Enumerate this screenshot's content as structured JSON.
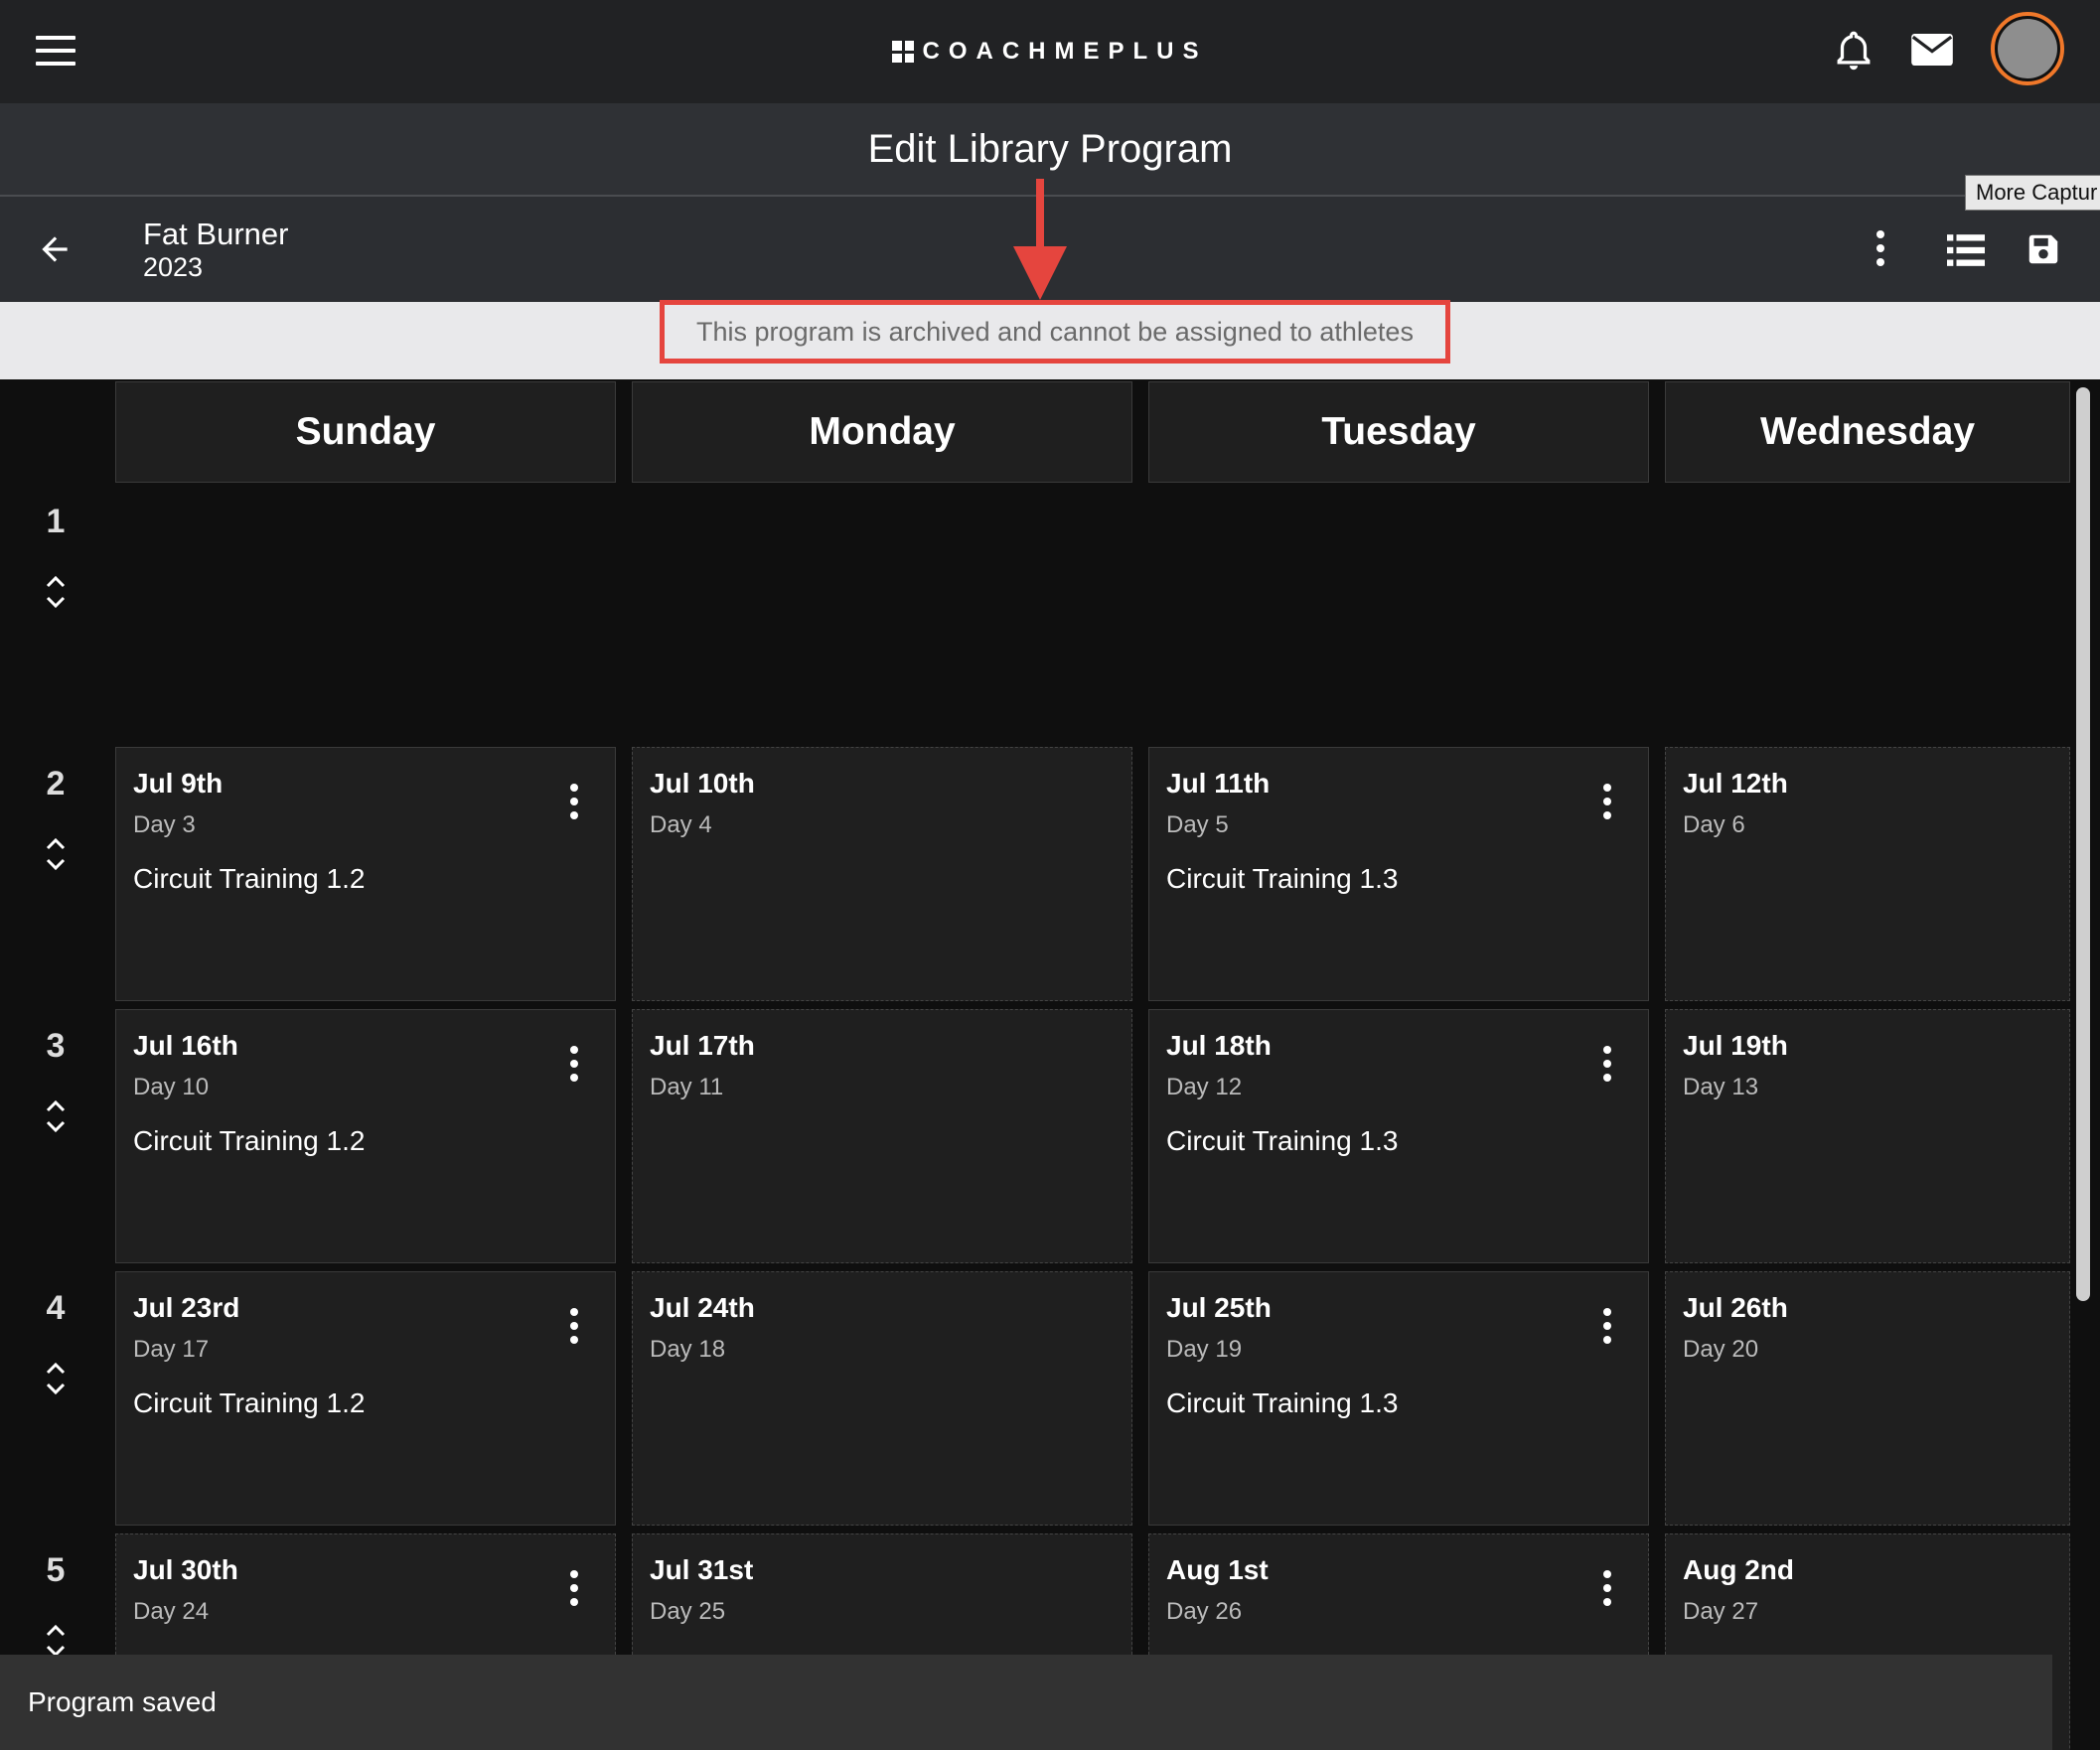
{
  "app": {
    "brand": "COACHMEPLUS"
  },
  "page": {
    "title": "Edit Library Program"
  },
  "program": {
    "name": "Fat Burner",
    "year": "2023"
  },
  "tooltip": {
    "text": "More Captur"
  },
  "notice": {
    "archived": "This program is archived and cannot be assigned to athletes"
  },
  "days": [
    "Sunday",
    "Monday",
    "Tuesday",
    "Wednesday"
  ],
  "weeks": [
    "1",
    "2",
    "3",
    "4",
    "5"
  ],
  "cells": [
    [
      {
        "date": "Jul 9th",
        "day": "Day 3",
        "workout": "Circuit Training 1.2"
      },
      {
        "date": "Jul 10th",
        "day": "Day 4",
        "workout": ""
      },
      {
        "date": "Jul 11th",
        "day": "Day 5",
        "workout": "Circuit Training 1.3"
      },
      {
        "date": "Jul 12th",
        "day": "Day 6",
        "workout": ""
      }
    ],
    [
      {
        "date": "Jul 16th",
        "day": "Day 10",
        "workout": "Circuit Training 1.2"
      },
      {
        "date": "Jul 17th",
        "day": "Day 11",
        "workout": ""
      },
      {
        "date": "Jul 18th",
        "day": "Day 12",
        "workout": "Circuit Training 1.3"
      },
      {
        "date": "Jul 19th",
        "day": "Day 13",
        "workout": ""
      }
    ],
    [
      {
        "date": "Jul 23rd",
        "day": "Day 17",
        "workout": "Circuit Training 1.2"
      },
      {
        "date": "Jul 24th",
        "day": "Day 18",
        "workout": ""
      },
      {
        "date": "Jul 25th",
        "day": "Day 19",
        "workout": "Circuit Training 1.3"
      },
      {
        "date": "Jul 26th",
        "day": "Day 20",
        "workout": ""
      }
    ],
    [
      {
        "date": "Jul 30th",
        "day": "Day 24",
        "workout": ""
      },
      {
        "date": "Jul 31st",
        "day": "Day 25",
        "workout": ""
      },
      {
        "date": "Aug 1st",
        "day": "Day 26",
        "workout": ""
      },
      {
        "date": "Aug 2nd",
        "day": "Day 27",
        "workout": ""
      }
    ]
  ],
  "snackbar": {
    "message": "Program saved"
  },
  "colors": {
    "accent": "#f0782a",
    "annotation": "#e5453e"
  }
}
